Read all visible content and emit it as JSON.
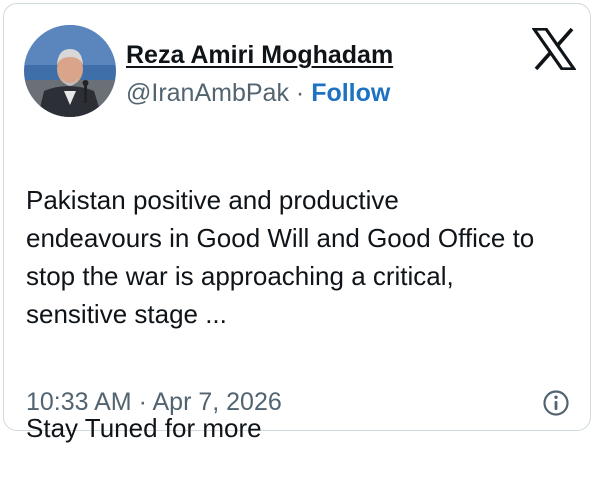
{
  "author": {
    "display_name": "Reza Amiri Moghadam",
    "handle": "@IranAmbPak",
    "separator": "·",
    "follow_label": "Follow"
  },
  "tweet": {
    "paragraph1": "Pakistan positive and productive\nendeavours in Good Will and Good Office to\nstop the war is approaching a critical,\nsensitive stage ...",
    "paragraph2": "Stay Tuned for more"
  },
  "meta": {
    "time": "10:33 AM",
    "separator": "·",
    "date": "Apr 7, 2026"
  },
  "icons": {
    "platform_logo": "x-logo-icon",
    "info": "info-icon"
  },
  "colors": {
    "follow_link": "#1d72c2",
    "secondary_text": "#536471",
    "primary_text": "#0f1419",
    "border": "#cfd9de"
  }
}
